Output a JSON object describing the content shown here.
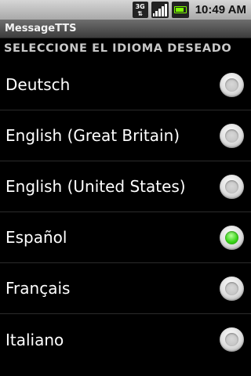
{
  "status_bar": {
    "network_label": "3G",
    "time": "10:49 AM",
    "battery_color": "#7cfc00"
  },
  "app": {
    "title": "MessageTTS"
  },
  "header": {
    "text": "SELECCIONE EL IDIOMA DESEADO"
  },
  "languages": [
    {
      "label": "Deutsch",
      "selected": false
    },
    {
      "label": "English (Great Britain)",
      "selected": false
    },
    {
      "label": "English (United States)",
      "selected": false
    },
    {
      "label": "Español",
      "selected": true
    },
    {
      "label": "Français",
      "selected": false
    },
    {
      "label": "Italiano",
      "selected": false
    }
  ],
  "colors": {
    "background": "#000000",
    "selected_radio": "#3bd61a",
    "header_text": "#c8c8c8"
  }
}
